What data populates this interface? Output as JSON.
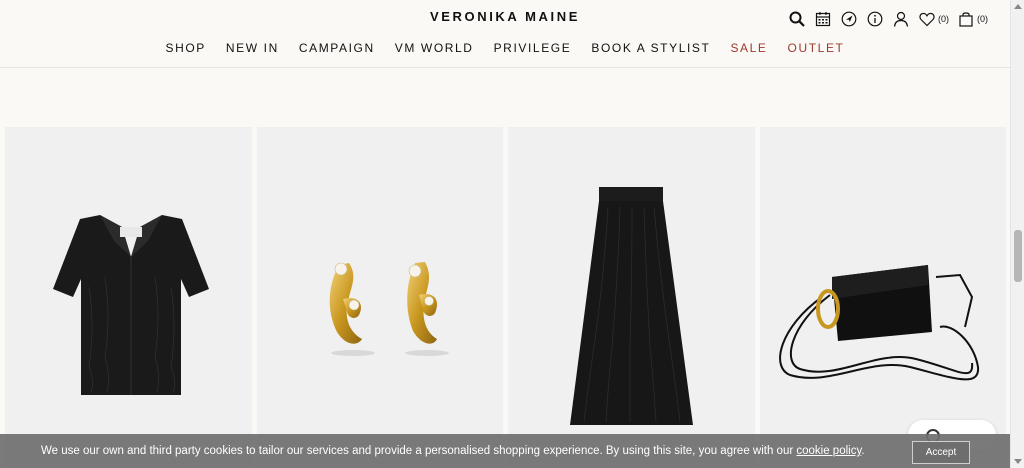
{
  "brand": {
    "name": "VERONIKA MAINE"
  },
  "header_icons": {
    "wishlist_count": "(0)",
    "bag_count": "(0)"
  },
  "nav": [
    {
      "label": "SHOP",
      "highlight": false
    },
    {
      "label": "NEW IN",
      "highlight": false
    },
    {
      "label": "CAMPAIGN",
      "highlight": false
    },
    {
      "label": "VM WORLD",
      "highlight": false
    },
    {
      "label": "PRIVILEGE",
      "highlight": false
    },
    {
      "label": "BOOK A STYLIST",
      "highlight": false
    },
    {
      "label": "SALE",
      "highlight": true
    },
    {
      "label": "OUTLET",
      "highlight": true
    }
  ],
  "products": [
    {
      "image": "black-short-sleeve-shirt"
    },
    {
      "image": "gold-pearl-hoop-earrings"
    },
    {
      "image": "black-textured-midi-skirt"
    },
    {
      "image": "black-leather-crossbody-bag"
    }
  ],
  "cookie": {
    "text": "We use our own and third party cookies to tailor our services and provide a personalised shopping experience. By using this site, you agree with our ",
    "link_label": "cookie policy",
    "suffix": ".",
    "accept_label": "Accept"
  },
  "colors": {
    "accent_red": "#a1382c",
    "background": "#faf9f6",
    "card_bg": "#f0f0f0"
  }
}
